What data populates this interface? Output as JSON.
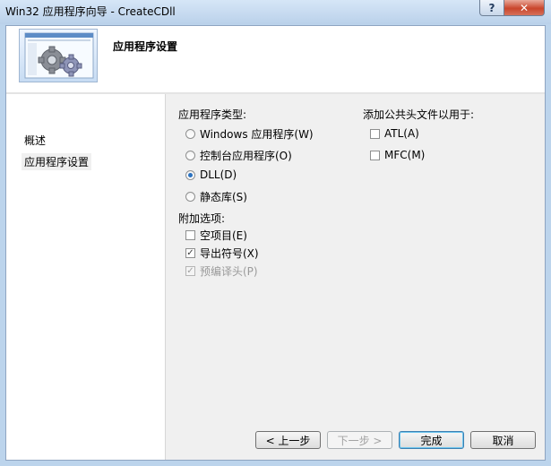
{
  "window": {
    "title": "Win32 应用程序向导 - CreateCDll",
    "help_glyph": "?",
    "close_glyph": "✕"
  },
  "header": {
    "title": "应用程序设置",
    "image_icon": "gears-icon"
  },
  "nav": {
    "items": [
      {
        "label": "概述",
        "active": false
      },
      {
        "label": "应用程序设置",
        "active": true
      }
    ]
  },
  "app_type": {
    "label": "应用程序类型:",
    "options": [
      {
        "label": "Windows 应用程序(W)",
        "checked": false
      },
      {
        "label": "控制台应用程序(O)",
        "checked": false
      },
      {
        "label": "DLL(D)",
        "checked": true
      },
      {
        "label": "静态库(S)",
        "checked": false
      }
    ]
  },
  "extra_options": {
    "label": "附加选项:",
    "options": [
      {
        "label": "空项目(E)",
        "checked": false,
        "enabled": true
      },
      {
        "label": "导出符号(X)",
        "checked": true,
        "enabled": true
      },
      {
        "label": "预编译头(P)",
        "checked": true,
        "enabled": false
      }
    ]
  },
  "common_headers": {
    "label": "添加公共头文件以用于:",
    "options": [
      {
        "label": "ATL(A)",
        "checked": false
      },
      {
        "label": "MFC(M)",
        "checked": false
      }
    ]
  },
  "buttons": {
    "prev": "< 上一步",
    "next": "下一步 >",
    "finish": "完成",
    "cancel": "取消"
  },
  "colors": {
    "title_bar": "#bad1ea",
    "close_button": "#c9462c",
    "radio_selected": "#2b72c0"
  }
}
